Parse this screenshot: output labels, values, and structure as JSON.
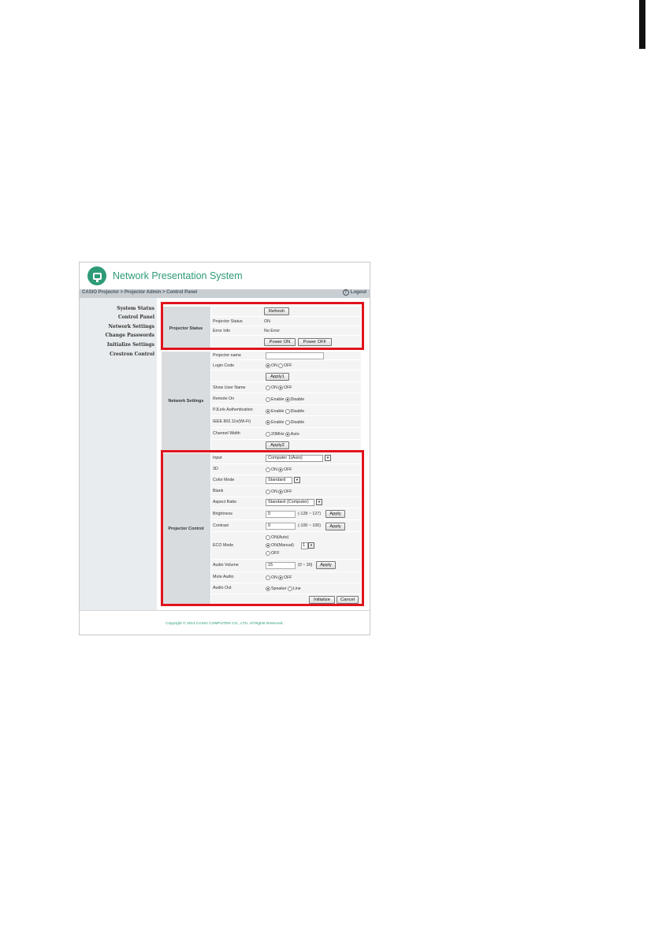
{
  "app": {
    "title": "Network Presentation System",
    "breadcrumb": "CASIO Projector > Projector Admin > Control Panel",
    "logout_label": "Logout",
    "accent_color": "#2e9b78",
    "highlight_color": "#e0141e"
  },
  "sidebar": {
    "items": [
      {
        "label": "System Status"
      },
      {
        "label": "Control Panel"
      },
      {
        "label": "Network Settings"
      },
      {
        "label": "Change Passwords"
      },
      {
        "label": "Initialize Settings"
      },
      {
        "label": "Crestron Control"
      }
    ]
  },
  "projector_status": {
    "section": "Projector Status",
    "refresh": "Refresh",
    "status_label": "Projector Status",
    "status_value": "ON",
    "error_label": "Error Info",
    "error_value": "No Error",
    "power_on": "Power ON",
    "power_off": "Power OFF"
  },
  "network_settings": {
    "section": "Network Settings",
    "projector_name_label": "Projector name",
    "projector_name_value": "",
    "login_code_label": "Login Code",
    "on": "ON",
    "off": "OFF",
    "apply1": "Apply1",
    "show_user_name_label": "Show User Name",
    "remote_on_label": "Remote On",
    "enable": "Enable",
    "disable": "Disable",
    "pjlink_label": "PJLink Authentication",
    "ieee_label": "IEEE 802.11n(Wi-Fi)",
    "channel_width_label": "Channel Width",
    "mhz20": "20MHz",
    "auto": "Auto",
    "apply2": "Apply2"
  },
  "projector_control": {
    "section": "Projector Control",
    "input_label": "Input",
    "input_value": "Computer 1(Auto)",
    "threed_label": "3D",
    "on": "ON",
    "off": "OFF",
    "color_mode_label": "Color Mode",
    "color_mode_value": "Standard",
    "blank_label": "Blank",
    "aspect_label": "Aspect Ratio",
    "aspect_value": "Standard (Computer)",
    "brightness_label": "Brightness",
    "brightness_value": "0",
    "brightness_range": "(-128 ~ 127)",
    "apply": "Apply",
    "contrast_label": "Contrast",
    "contrast_value": "0",
    "contrast_range": "(-100 ~ 100)",
    "eco_label": "ECO Mode",
    "eco_auto": "ON(Auto)",
    "eco_manual": "ON(Manual)",
    "eco_manual_level": "1",
    "eco_off": "OFF",
    "volume_label": "Audio Volume",
    "volume_value": "15",
    "volume_range": "(0 ~ 30)",
    "mute_label": "Mute Audio",
    "audio_out_label": "Audio Out",
    "speaker": "Speaker",
    "line": "Line",
    "initialize": "Initialize",
    "cancel": "Cancel"
  },
  "footer": {
    "copyright": "Copyright © 2014 CASIO COMPUTER CO., LTD. All Rights Reserved."
  }
}
